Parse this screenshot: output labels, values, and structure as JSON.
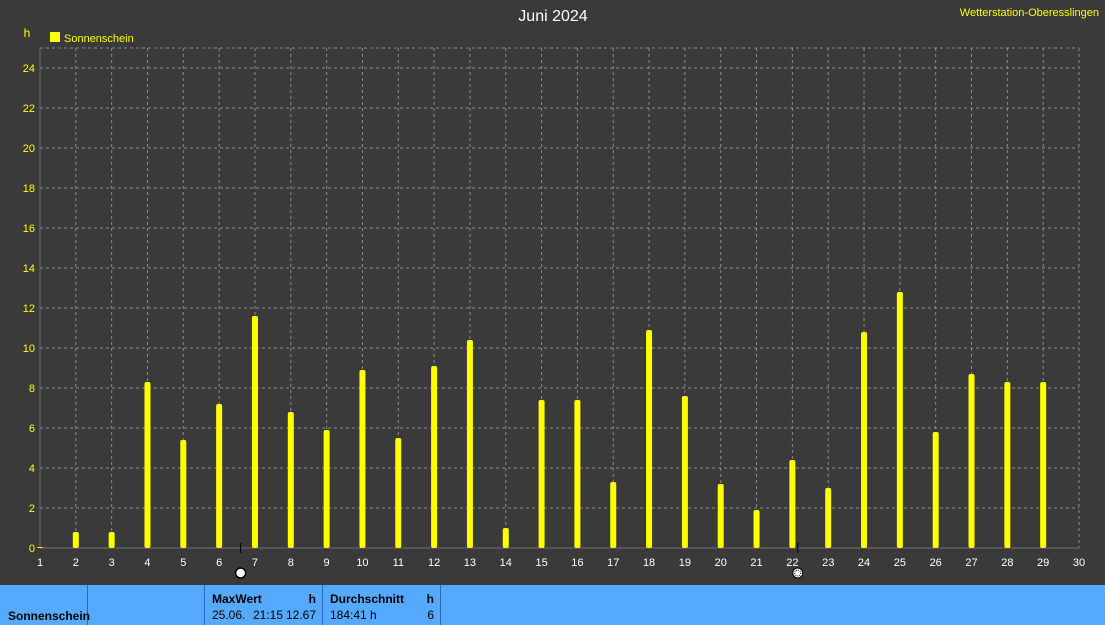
{
  "header": {
    "station": "Wetterstation-Oberesslingen"
  },
  "colors": {
    "background": "#3a3a3a",
    "bar": "#ffff00",
    "axis_text": "#ffff00",
    "x_tick_text": "#ffffff",
    "grid": "#8a8a8a",
    "panel": "#55aaff"
  },
  "chart_data": {
    "type": "bar",
    "title": "Juni 2024",
    "ylabel": "h",
    "xlabel": "",
    "ylim": [
      0,
      25
    ],
    "xlim": [
      1,
      30
    ],
    "yticks": [
      0,
      2,
      4,
      6,
      8,
      10,
      12,
      14,
      16,
      18,
      20,
      22,
      24
    ],
    "xticks": [
      1,
      2,
      3,
      4,
      5,
      6,
      7,
      8,
      9,
      10,
      11,
      12,
      13,
      14,
      15,
      16,
      17,
      18,
      19,
      20,
      21,
      22,
      23,
      24,
      25,
      26,
      27,
      28,
      29,
      30
    ],
    "grid": true,
    "legend_position": "top-left",
    "x": [
      1,
      2,
      3,
      4,
      5,
      6,
      7,
      8,
      9,
      10,
      11,
      12,
      13,
      14,
      15,
      16,
      17,
      18,
      19,
      20,
      21,
      22,
      23,
      24,
      25,
      26,
      27,
      28,
      29
    ],
    "series": [
      {
        "name": "Sonnenschein",
        "values": [
          0.05,
          0.8,
          0.8,
          8.3,
          5.4,
          7.2,
          11.6,
          6.8,
          5.9,
          8.9,
          5.5,
          9.1,
          10.4,
          1.0,
          7.4,
          7.4,
          3.3,
          10.9,
          7.6,
          3.2,
          1.9,
          4.4,
          3.0,
          10.8,
          12.8,
          5.8,
          8.7,
          8.3,
          8.3
        ]
      }
    ],
    "markers": [
      {
        "x": 6.6,
        "icon": "full-moon-icon"
      },
      {
        "x": 22.15,
        "icon": "new-moon-icon"
      }
    ]
  },
  "summary": {
    "label": "Sonnenschein",
    "max": {
      "title": "MaxWert",
      "unit": "h",
      "date": "25.06.",
      "time": "21:15",
      "value": "12.67"
    },
    "avg": {
      "title": "Durchschnitt",
      "unit": "h",
      "total": "184:41 h",
      "value": "6"
    }
  }
}
